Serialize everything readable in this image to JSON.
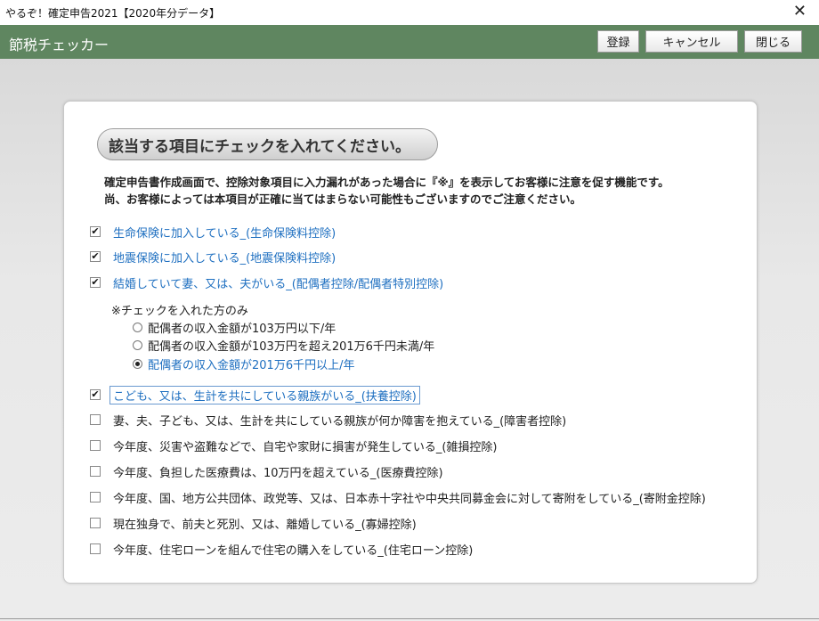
{
  "window": {
    "title": "やるぞ！確定申告2021【2020年分データ】",
    "close_glyph": "✕"
  },
  "header": {
    "title": "節税チェッカー",
    "buttons": {
      "register": "登録",
      "cancel": "キャンセル",
      "close": "閉じる"
    }
  },
  "panel": {
    "heading": "該当する項目にチェックを入れてください。",
    "description": [
      "確定申告書作成画面で、控除対象項目に入力漏れがあった場合に『※』を表示してお客様に注意を促す機能です。",
      "尚、お客様によっては本項目が正確に当てはまらない可能性もございますのでご注意ください。"
    ],
    "items": [
      {
        "label": "生命保険に加入している_(生命保険料控除)",
        "checked": true
      },
      {
        "label": "地震保険に加入している_(地震保険料控除)",
        "checked": true
      },
      {
        "label": "結婚していて妻、又は、夫がいる_(配偶者控除/配偶者特別控除)",
        "checked": true
      },
      {
        "label": "こども、又は、生計を共にしている親族がいる_(扶養控除)",
        "checked": true,
        "focused": true
      },
      {
        "label": "妻、夫、子ども、又は、生計を共にしている親族が何か障害を抱えている_(障害者控除)",
        "checked": false
      },
      {
        "label": "今年度、災害や盗難などで、自宅や家財に損害が発生している_(雑損控除)",
        "checked": false
      },
      {
        "label": "今年度、負担した医療費は、10万円を超えている_(医療費控除)",
        "checked": false
      },
      {
        "label": "今年度、国、地方公共団体、政党等、又は、日本赤十字社や中央共同募金会に対して寄附をしている_(寄附金控除)",
        "checked": false
      },
      {
        "label": "現在独身で、前夫と死別、又は、離婚している_(寡婦控除)",
        "checked": false
      },
      {
        "label": "今年度、住宅ローンを組んで住宅の購入をしている_(住宅ローン控除)",
        "checked": false
      }
    ],
    "spouse_note": "※チェックを入れた方のみ",
    "spouse_options": [
      {
        "label": "配偶者の収入金額が103万円以下/年",
        "selected": false
      },
      {
        "label": "配偶者の収入金額が103万円を超え201万6千円未満/年",
        "selected": false
      },
      {
        "label": "配偶者の収入金額が201万6千円以上/年",
        "selected": true
      }
    ],
    "check_glyph": "✔"
  },
  "colors": {
    "header_bg": "#5f8660",
    "checked_text": "#1e6fc0",
    "content_bg": "#e3e3e3"
  }
}
